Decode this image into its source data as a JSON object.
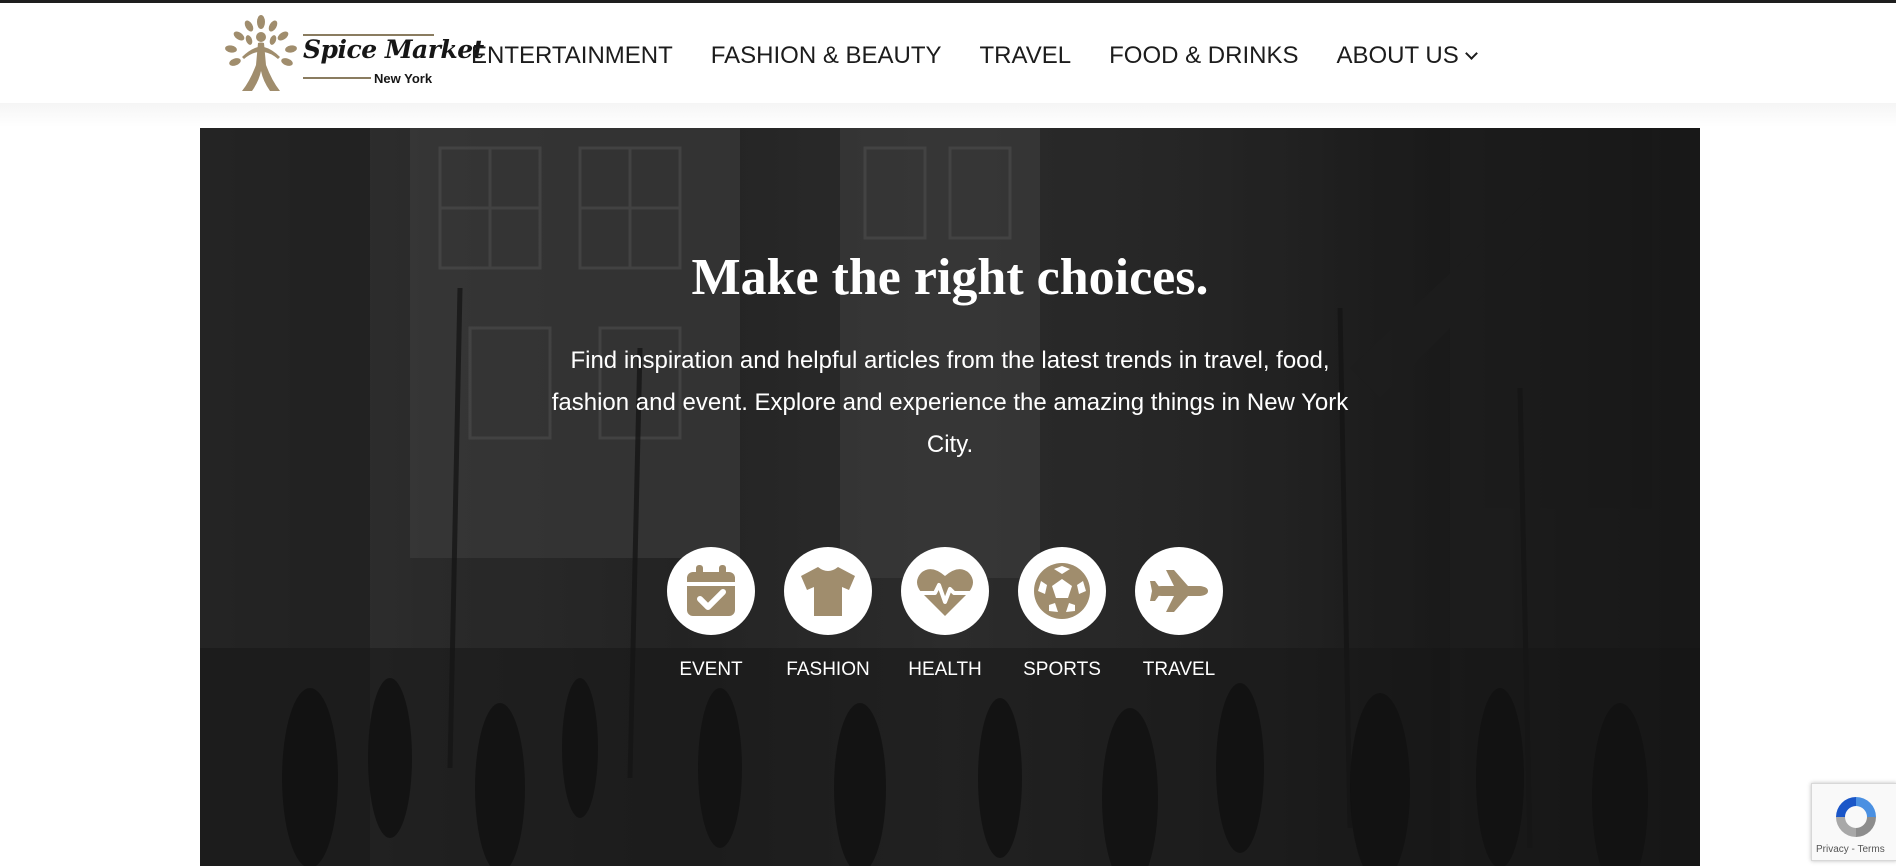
{
  "site": {
    "logo_title": "Spice Market",
    "logo_subtitle": "New York",
    "brand_color": "#a08d6d"
  },
  "nav": {
    "items": [
      {
        "label": "ENTERTAINMENT"
      },
      {
        "label": "FASHION & BEAUTY"
      },
      {
        "label": "TRAVEL"
      },
      {
        "label": "FOOD & DRINKS"
      },
      {
        "label": "ABOUT US",
        "icon": "chevron-down-icon"
      }
    ]
  },
  "hero": {
    "title": "Make the right choices.",
    "description": "Find inspiration and helpful articles from the latest trends in travel, food, fashion and event. Explore and experience the amazing things in New York City."
  },
  "categories": [
    {
      "label": "EVENT",
      "icon": "calendar-check-icon"
    },
    {
      "label": "FASHION",
      "icon": "tshirt-icon"
    },
    {
      "label": "HEALTH",
      "icon": "heartbeat-icon"
    },
    {
      "label": "SPORTS",
      "icon": "soccer-ball-icon"
    },
    {
      "label": "TRAVEL",
      "icon": "airplane-icon"
    }
  ],
  "recaptcha": {
    "text": "Privacy - Terms"
  }
}
